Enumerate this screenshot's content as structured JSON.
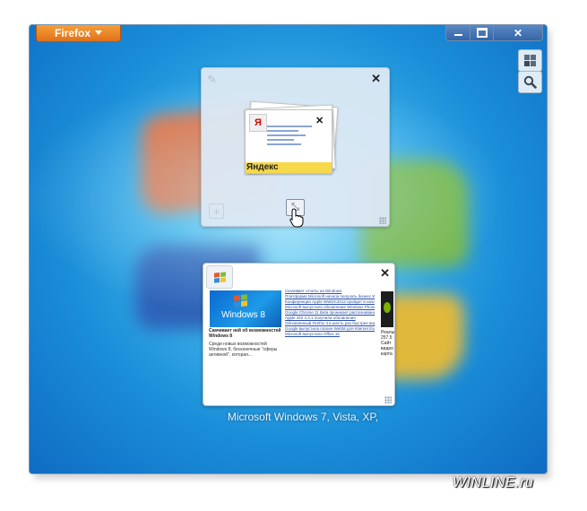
{
  "window": {
    "menu_button_label": "Firefox",
    "controls": {
      "minimize": "minimize",
      "maximize": "maximize",
      "close": "✕"
    },
    "side_buttons": [
      "tab-groups-icon",
      "search-icon"
    ]
  },
  "group": {
    "close_label": "✕",
    "plus_label": "+",
    "expand_label": "⤡",
    "tab_logo_letter": "Я",
    "tab_close_label": "✕",
    "tab_site_label": "Яндекс"
  },
  "tab": {
    "close_label": "✕",
    "headline": "Скачивает ней об возможностей Windows 8",
    "image_label": "Windows 8",
    "summary": "Среди новых возможностей Windows 8, бесконечные \"сферы активной\", которая...",
    "news_items": [
      "Скачивает отчеты на Windows",
      "Платформа Microsoft начала получать бизнес Windows 8",
      "Конференция Apple WWDC2012 пройдет в начале июня",
      "Microsoft выпустила обновление Windows Phone",
      "Google Chrome 11 Beta проникает распознавание с сайтами",
      "Apple iOS 4.3.1 получила обновления",
      "Обновленный Firefox 4 в шесть раз быстрее версии 3.6",
      "Google выпустила плагин WebM для Internet Explorer 9",
      "Microsoft выпустила Office 15"
    ],
    "right_text": "Реалы 257.5 Сайт видео карта",
    "title": "Microsoft Windows 7, Vista, XP,"
  },
  "watermark": "WINLINE.ru"
}
